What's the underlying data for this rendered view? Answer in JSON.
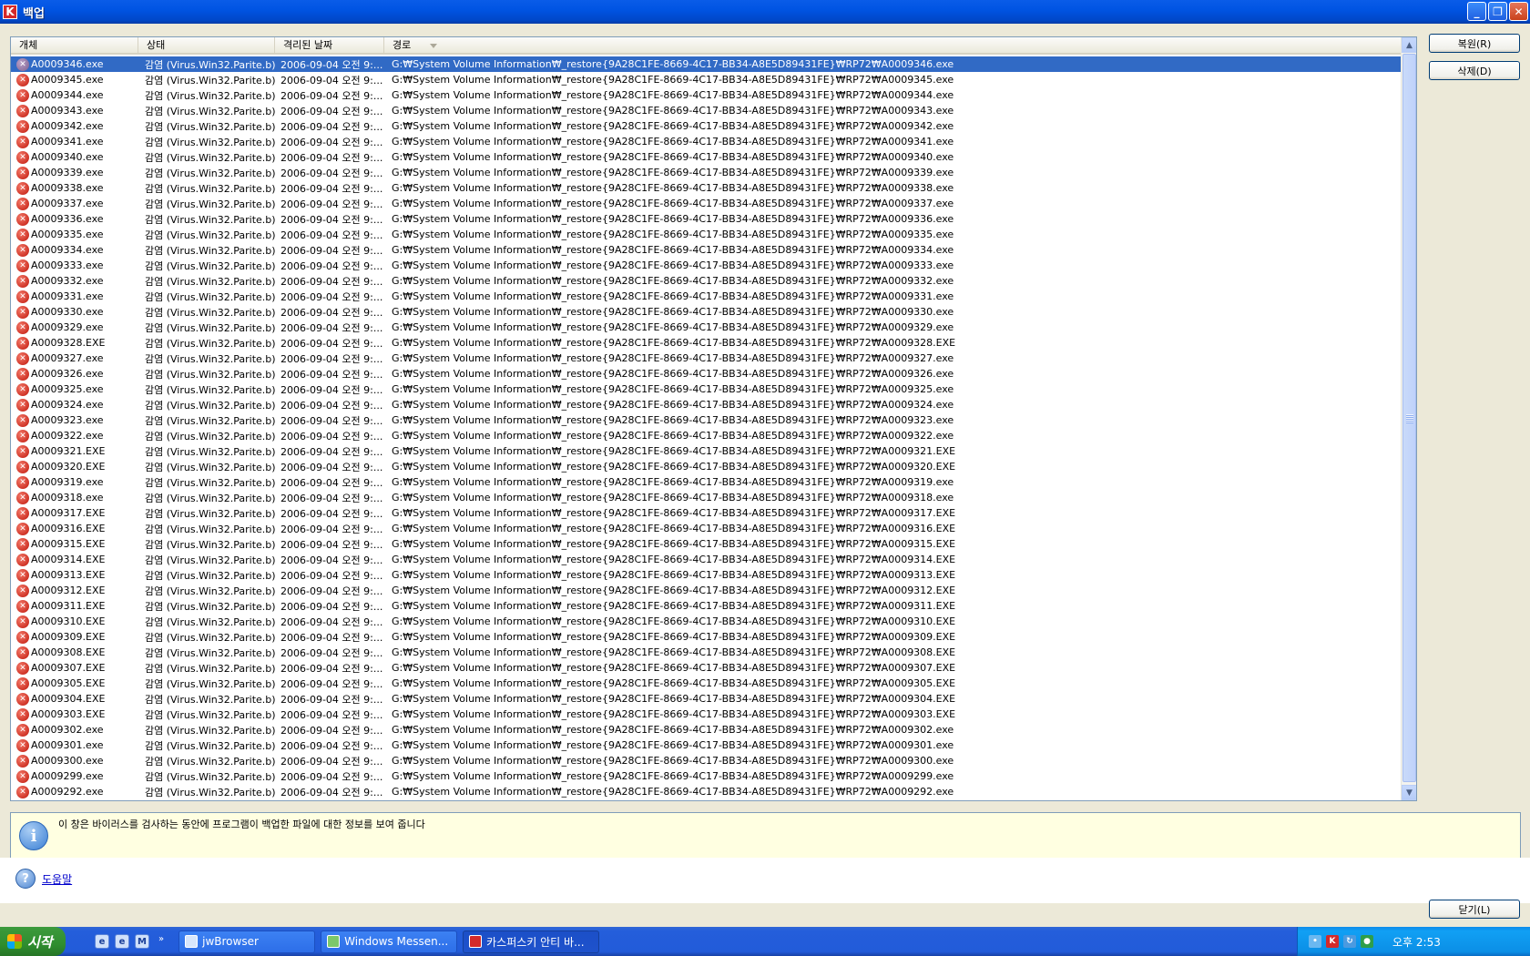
{
  "window": {
    "title": "백업",
    "app_icon_glyph": "K",
    "controls": {
      "minimize": "_",
      "maximize": "❐",
      "close": "✕"
    }
  },
  "list": {
    "columns": [
      "개체",
      "상태",
      "격리된 날짜",
      "경로"
    ],
    "rows": [
      {
        "object": "A0009346.exe",
        "status": "감염 (Virus.Win32.Parite.b)",
        "date": "2006-09-04 오전 9:...",
        "path": "G:₩System Volume Information₩_restore{9A28C1FE-8669-4C17-BB34-A8E5D89431FE}₩RP72₩A0009346.exe"
      },
      {
        "object": "A0009345.exe",
        "status": "감염 (Virus.Win32.Parite.b)",
        "date": "2006-09-04 오전 9:...",
        "path": "G:₩System Volume Information₩_restore{9A28C1FE-8669-4C17-BB34-A8E5D89431FE}₩RP72₩A0009345.exe"
      },
      {
        "object": "A0009344.exe",
        "status": "감염 (Virus.Win32.Parite.b)",
        "date": "2006-09-04 오전 9:...",
        "path": "G:₩System Volume Information₩_restore{9A28C1FE-8669-4C17-BB34-A8E5D89431FE}₩RP72₩A0009344.exe"
      },
      {
        "object": "A0009343.exe",
        "status": "감염 (Virus.Win32.Parite.b)",
        "date": "2006-09-04 오전 9:...",
        "path": "G:₩System Volume Information₩_restore{9A28C1FE-8669-4C17-BB34-A8E5D89431FE}₩RP72₩A0009343.exe"
      },
      {
        "object": "A0009342.exe",
        "status": "감염 (Virus.Win32.Parite.b)",
        "date": "2006-09-04 오전 9:...",
        "path": "G:₩System Volume Information₩_restore{9A28C1FE-8669-4C17-BB34-A8E5D89431FE}₩RP72₩A0009342.exe"
      },
      {
        "object": "A0009341.exe",
        "status": "감염 (Virus.Win32.Parite.b)",
        "date": "2006-09-04 오전 9:...",
        "path": "G:₩System Volume Information₩_restore{9A28C1FE-8669-4C17-BB34-A8E5D89431FE}₩RP72₩A0009341.exe"
      },
      {
        "object": "A0009340.exe",
        "status": "감염 (Virus.Win32.Parite.b)",
        "date": "2006-09-04 오전 9:...",
        "path": "G:₩System Volume Information₩_restore{9A28C1FE-8669-4C17-BB34-A8E5D89431FE}₩RP72₩A0009340.exe"
      },
      {
        "object": "A0009339.exe",
        "status": "감염 (Virus.Win32.Parite.b)",
        "date": "2006-09-04 오전 9:...",
        "path": "G:₩System Volume Information₩_restore{9A28C1FE-8669-4C17-BB34-A8E5D89431FE}₩RP72₩A0009339.exe"
      },
      {
        "object": "A0009338.exe",
        "status": "감염 (Virus.Win32.Parite.b)",
        "date": "2006-09-04 오전 9:...",
        "path": "G:₩System Volume Information₩_restore{9A28C1FE-8669-4C17-BB34-A8E5D89431FE}₩RP72₩A0009338.exe"
      },
      {
        "object": "A0009337.exe",
        "status": "감염 (Virus.Win32.Parite.b)",
        "date": "2006-09-04 오전 9:...",
        "path": "G:₩System Volume Information₩_restore{9A28C1FE-8669-4C17-BB34-A8E5D89431FE}₩RP72₩A0009337.exe"
      },
      {
        "object": "A0009336.exe",
        "status": "감염 (Virus.Win32.Parite.b)",
        "date": "2006-09-04 오전 9:...",
        "path": "G:₩System Volume Information₩_restore{9A28C1FE-8669-4C17-BB34-A8E5D89431FE}₩RP72₩A0009336.exe"
      },
      {
        "object": "A0009335.exe",
        "status": "감염 (Virus.Win32.Parite.b)",
        "date": "2006-09-04 오전 9:...",
        "path": "G:₩System Volume Information₩_restore{9A28C1FE-8669-4C17-BB34-A8E5D89431FE}₩RP72₩A0009335.exe"
      },
      {
        "object": "A0009334.exe",
        "status": "감염 (Virus.Win32.Parite.b)",
        "date": "2006-09-04 오전 9:...",
        "path": "G:₩System Volume Information₩_restore{9A28C1FE-8669-4C17-BB34-A8E5D89431FE}₩RP72₩A0009334.exe"
      },
      {
        "object": "A0009333.exe",
        "status": "감염 (Virus.Win32.Parite.b)",
        "date": "2006-09-04 오전 9:...",
        "path": "G:₩System Volume Information₩_restore{9A28C1FE-8669-4C17-BB34-A8E5D89431FE}₩RP72₩A0009333.exe"
      },
      {
        "object": "A0009332.exe",
        "status": "감염 (Virus.Win32.Parite.b)",
        "date": "2006-09-04 오전 9:...",
        "path": "G:₩System Volume Information₩_restore{9A28C1FE-8669-4C17-BB34-A8E5D89431FE}₩RP72₩A0009332.exe"
      },
      {
        "object": "A0009331.exe",
        "status": "감염 (Virus.Win32.Parite.b)",
        "date": "2006-09-04 오전 9:...",
        "path": "G:₩System Volume Information₩_restore{9A28C1FE-8669-4C17-BB34-A8E5D89431FE}₩RP72₩A0009331.exe"
      },
      {
        "object": "A0009330.exe",
        "status": "감염 (Virus.Win32.Parite.b)",
        "date": "2006-09-04 오전 9:...",
        "path": "G:₩System Volume Information₩_restore{9A28C1FE-8669-4C17-BB34-A8E5D89431FE}₩RP72₩A0009330.exe"
      },
      {
        "object": "A0009329.exe",
        "status": "감염 (Virus.Win32.Parite.b)",
        "date": "2006-09-04 오전 9:...",
        "path": "G:₩System Volume Information₩_restore{9A28C1FE-8669-4C17-BB34-A8E5D89431FE}₩RP72₩A0009329.exe"
      },
      {
        "object": "A0009328.EXE",
        "status": "감염 (Virus.Win32.Parite.b)",
        "date": "2006-09-04 오전 9:...",
        "path": "G:₩System Volume Information₩_restore{9A28C1FE-8669-4C17-BB34-A8E5D89431FE}₩RP72₩A0009328.EXE"
      },
      {
        "object": "A0009327.exe",
        "status": "감염 (Virus.Win32.Parite.b)",
        "date": "2006-09-04 오전 9:...",
        "path": "G:₩System Volume Information₩_restore{9A28C1FE-8669-4C17-BB34-A8E5D89431FE}₩RP72₩A0009327.exe"
      },
      {
        "object": "A0009326.exe",
        "status": "감염 (Virus.Win32.Parite.b)",
        "date": "2006-09-04 오전 9:...",
        "path": "G:₩System Volume Information₩_restore{9A28C1FE-8669-4C17-BB34-A8E5D89431FE}₩RP72₩A0009326.exe"
      },
      {
        "object": "A0009325.exe",
        "status": "감염 (Virus.Win32.Parite.b)",
        "date": "2006-09-04 오전 9:...",
        "path": "G:₩System Volume Information₩_restore{9A28C1FE-8669-4C17-BB34-A8E5D89431FE}₩RP72₩A0009325.exe"
      },
      {
        "object": "A0009324.exe",
        "status": "감염 (Virus.Win32.Parite.b)",
        "date": "2006-09-04 오전 9:...",
        "path": "G:₩System Volume Information₩_restore{9A28C1FE-8669-4C17-BB34-A8E5D89431FE}₩RP72₩A0009324.exe"
      },
      {
        "object": "A0009323.exe",
        "status": "감염 (Virus.Win32.Parite.b)",
        "date": "2006-09-04 오전 9:...",
        "path": "G:₩System Volume Information₩_restore{9A28C1FE-8669-4C17-BB34-A8E5D89431FE}₩RP72₩A0009323.exe"
      },
      {
        "object": "A0009322.exe",
        "status": "감염 (Virus.Win32.Parite.b)",
        "date": "2006-09-04 오전 9:...",
        "path": "G:₩System Volume Information₩_restore{9A28C1FE-8669-4C17-BB34-A8E5D89431FE}₩RP72₩A0009322.exe"
      },
      {
        "object": "A0009321.EXE",
        "status": "감염 (Virus.Win32.Parite.b)",
        "date": "2006-09-04 오전 9:...",
        "path": "G:₩System Volume Information₩_restore{9A28C1FE-8669-4C17-BB34-A8E5D89431FE}₩RP72₩A0009321.EXE"
      },
      {
        "object": "A0009320.EXE",
        "status": "감염 (Virus.Win32.Parite.b)",
        "date": "2006-09-04 오전 9:...",
        "path": "G:₩System Volume Information₩_restore{9A28C1FE-8669-4C17-BB34-A8E5D89431FE}₩RP72₩A0009320.EXE"
      },
      {
        "object": "A0009319.exe",
        "status": "감염 (Virus.Win32.Parite.b)",
        "date": "2006-09-04 오전 9:...",
        "path": "G:₩System Volume Information₩_restore{9A28C1FE-8669-4C17-BB34-A8E5D89431FE}₩RP72₩A0009319.exe"
      },
      {
        "object": "A0009318.exe",
        "status": "감염 (Virus.Win32.Parite.b)",
        "date": "2006-09-04 오전 9:...",
        "path": "G:₩System Volume Information₩_restore{9A28C1FE-8669-4C17-BB34-A8E5D89431FE}₩RP72₩A0009318.exe"
      },
      {
        "object": "A0009317.EXE",
        "status": "감염 (Virus.Win32.Parite.b)",
        "date": "2006-09-04 오전 9:...",
        "path": "G:₩System Volume Information₩_restore{9A28C1FE-8669-4C17-BB34-A8E5D89431FE}₩RP72₩A0009317.EXE"
      },
      {
        "object": "A0009316.EXE",
        "status": "감염 (Virus.Win32.Parite.b)",
        "date": "2006-09-04 오전 9:...",
        "path": "G:₩System Volume Information₩_restore{9A28C1FE-8669-4C17-BB34-A8E5D89431FE}₩RP72₩A0009316.EXE"
      },
      {
        "object": "A0009315.EXE",
        "status": "감염 (Virus.Win32.Parite.b)",
        "date": "2006-09-04 오전 9:...",
        "path": "G:₩System Volume Information₩_restore{9A28C1FE-8669-4C17-BB34-A8E5D89431FE}₩RP72₩A0009315.EXE"
      },
      {
        "object": "A0009314.EXE",
        "status": "감염 (Virus.Win32.Parite.b)",
        "date": "2006-09-04 오전 9:...",
        "path": "G:₩System Volume Information₩_restore{9A28C1FE-8669-4C17-BB34-A8E5D89431FE}₩RP72₩A0009314.EXE"
      },
      {
        "object": "A0009313.EXE",
        "status": "감염 (Virus.Win32.Parite.b)",
        "date": "2006-09-04 오전 9:...",
        "path": "G:₩System Volume Information₩_restore{9A28C1FE-8669-4C17-BB34-A8E5D89431FE}₩RP72₩A0009313.EXE"
      },
      {
        "object": "A0009312.EXE",
        "status": "감염 (Virus.Win32.Parite.b)",
        "date": "2006-09-04 오전 9:...",
        "path": "G:₩System Volume Information₩_restore{9A28C1FE-8669-4C17-BB34-A8E5D89431FE}₩RP72₩A0009312.EXE"
      },
      {
        "object": "A0009311.EXE",
        "status": "감염 (Virus.Win32.Parite.b)",
        "date": "2006-09-04 오전 9:...",
        "path": "G:₩System Volume Information₩_restore{9A28C1FE-8669-4C17-BB34-A8E5D89431FE}₩RP72₩A0009311.EXE"
      },
      {
        "object": "A0009310.EXE",
        "status": "감염 (Virus.Win32.Parite.b)",
        "date": "2006-09-04 오전 9:...",
        "path": "G:₩System Volume Information₩_restore{9A28C1FE-8669-4C17-BB34-A8E5D89431FE}₩RP72₩A0009310.EXE"
      },
      {
        "object": "A0009309.EXE",
        "status": "감염 (Virus.Win32.Parite.b)",
        "date": "2006-09-04 오전 9:...",
        "path": "G:₩System Volume Information₩_restore{9A28C1FE-8669-4C17-BB34-A8E5D89431FE}₩RP72₩A0009309.EXE"
      },
      {
        "object": "A0009308.EXE",
        "status": "감염 (Virus.Win32.Parite.b)",
        "date": "2006-09-04 오전 9:...",
        "path": "G:₩System Volume Information₩_restore{9A28C1FE-8669-4C17-BB34-A8E5D89431FE}₩RP72₩A0009308.EXE"
      },
      {
        "object": "A0009307.EXE",
        "status": "감염 (Virus.Win32.Parite.b)",
        "date": "2006-09-04 오전 9:...",
        "path": "G:₩System Volume Information₩_restore{9A28C1FE-8669-4C17-BB34-A8E5D89431FE}₩RP72₩A0009307.EXE"
      },
      {
        "object": "A0009305.EXE",
        "status": "감염 (Virus.Win32.Parite.b)",
        "date": "2006-09-04 오전 9:...",
        "path": "G:₩System Volume Information₩_restore{9A28C1FE-8669-4C17-BB34-A8E5D89431FE}₩RP72₩A0009305.EXE"
      },
      {
        "object": "A0009304.EXE",
        "status": "감염 (Virus.Win32.Parite.b)",
        "date": "2006-09-04 오전 9:...",
        "path": "G:₩System Volume Information₩_restore{9A28C1FE-8669-4C17-BB34-A8E5D89431FE}₩RP72₩A0009304.EXE"
      },
      {
        "object": "A0009303.EXE",
        "status": "감염 (Virus.Win32.Parite.b)",
        "date": "2006-09-04 오전 9:...",
        "path": "G:₩System Volume Information₩_restore{9A28C1FE-8669-4C17-BB34-A8E5D89431FE}₩RP72₩A0009303.EXE"
      },
      {
        "object": "A0009302.exe",
        "status": "감염 (Virus.Win32.Parite.b)",
        "date": "2006-09-04 오전 9:...",
        "path": "G:₩System Volume Information₩_restore{9A28C1FE-8669-4C17-BB34-A8E5D89431FE}₩RP72₩A0009302.exe"
      },
      {
        "object": "A0009301.exe",
        "status": "감염 (Virus.Win32.Parite.b)",
        "date": "2006-09-04 오전 9:...",
        "path": "G:₩System Volume Information₩_restore{9A28C1FE-8669-4C17-BB34-A8E5D89431FE}₩RP72₩A0009301.exe"
      },
      {
        "object": "A0009300.exe",
        "status": "감염 (Virus.Win32.Parite.b)",
        "date": "2006-09-04 오전 9:...",
        "path": "G:₩System Volume Information₩_restore{9A28C1FE-8669-4C17-BB34-A8E5D89431FE}₩RP72₩A0009300.exe"
      },
      {
        "object": "A0009299.exe",
        "status": "감염 (Virus.Win32.Parite.b)",
        "date": "2006-09-04 오전 9:...",
        "path": "G:₩System Volume Information₩_restore{9A28C1FE-8669-4C17-BB34-A8E5D89431FE}₩RP72₩A0009299.exe"
      },
      {
        "object": "A0009292.exe",
        "status": "감염 (Virus.Win32.Parite.b)",
        "date": "2006-09-04 오전 9:...",
        "path": "G:₩System Volume Information₩_restore{9A28C1FE-8669-4C17-BB34-A8E5D89431FE}₩RP72₩A0009292.exe"
      }
    ]
  },
  "buttons": {
    "restore": "복원(R)",
    "delete": "삭제(D)",
    "close": "닫기(L)"
  },
  "info": {
    "message": "이 창은 바이러스를 검사하는 동안에 프로그램이 백업한 파일에 대한 정보를 보여 줍니다"
  },
  "help": {
    "label": "도움말"
  },
  "taskbar": {
    "start_label": "시작",
    "quick_launch": [
      "e",
      "e",
      "M"
    ],
    "buttons": [
      "jwBrowser",
      "Windows Messen...",
      "카스퍼스키 안티 바..."
    ],
    "clock": "오후 2:53"
  }
}
